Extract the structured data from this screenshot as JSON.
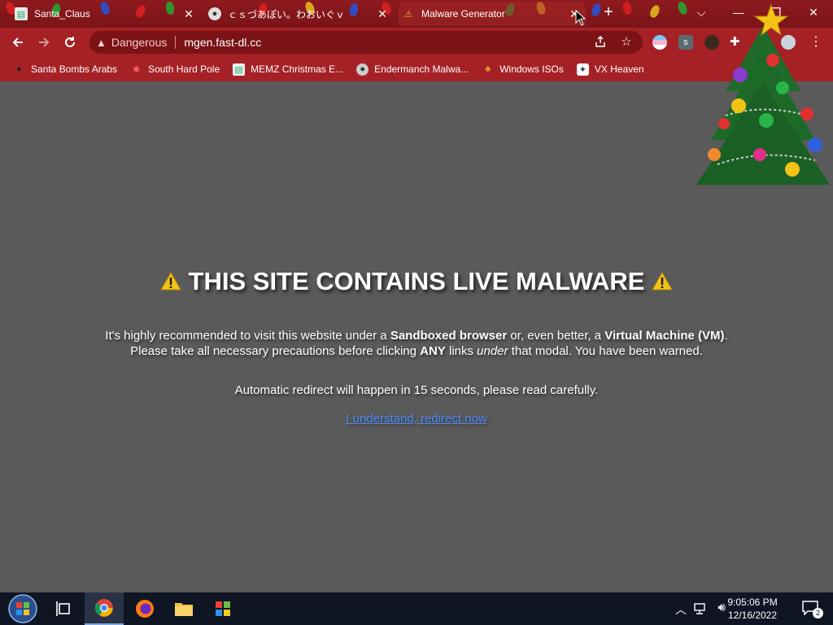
{
  "tabs": [
    {
      "title": "Santa_Claus",
      "close": "✕"
    },
    {
      "title": "ｃｓづあぽい。わおいぐｖ",
      "close": "✕"
    },
    {
      "title": "Malware Generator",
      "close": "✕"
    }
  ],
  "window_controls": {
    "new_tab": "+",
    "menu": "⌵",
    "minimize": "—",
    "maximize": "❐",
    "close": "✕"
  },
  "omnibox": {
    "security_label": "Dangerous",
    "url": "mgen.fast-dl.cc"
  },
  "bookmarks": [
    {
      "label": "Santa Bombs Arabs",
      "icon": "bomb-icon"
    },
    {
      "label": "South Hard Pole",
      "icon": "snowflake-icon"
    },
    {
      "label": "MEMZ Christmas E...",
      "icon": "page-icon"
    },
    {
      "label": "Endermanch Malwa...",
      "icon": "raccoon-icon"
    },
    {
      "label": "Windows ISOs",
      "icon": "gnome-icon"
    },
    {
      "label": "VX Heaven",
      "icon": "shield-icon"
    }
  ],
  "page": {
    "headline": "THIS SITE CONTAINS LIVE MALWARE",
    "line1_a": "It's highly recommended to visit this website under a ",
    "line1_b": "Sandboxed browser",
    "line1_c": " or, even better, a ",
    "line1_d": "Virtual Machine (VM)",
    "line1_e": ".",
    "line2_a": "Please take all necessary precautions before clicking ",
    "line2_b": "ANY",
    "line2_c": " links ",
    "line2_d": "under",
    "line2_e": " that modal. You have been warned.",
    "redirect": "Automatic redirect will happen in 15 seconds, please read carefully.",
    "link": "I understand, redirect now"
  },
  "taskbar": {
    "time": "9:05:06 PM",
    "date": "12/16/2022",
    "notifications": "2"
  },
  "colors": {
    "frame": "#a52125",
    "page_bg": "#5a5a5a",
    "link": "#4c8bf5"
  }
}
